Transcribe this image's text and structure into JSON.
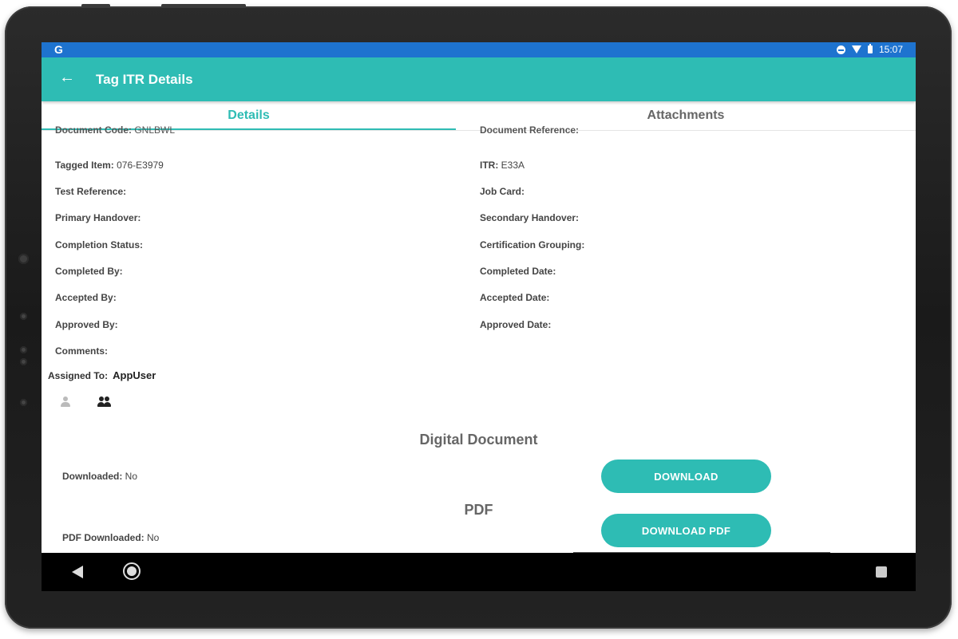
{
  "status_bar": {
    "left_glyph": "G",
    "time": "15:07",
    "icons": [
      "do-not-disturb-icon",
      "wifi-icon",
      "battery-icon"
    ]
  },
  "app_bar": {
    "back_icon": "arrow-back-icon",
    "title": "Tag ITR Details"
  },
  "tabs": [
    {
      "label": "Details",
      "active": true
    },
    {
      "label": "Attachments",
      "active": false
    }
  ],
  "details": {
    "left": [
      {
        "label": "Document Code:",
        "value": "GNLBWL"
      },
      {
        "label": "Tagged Item:",
        "value": "076-E3979"
      },
      {
        "label": "Test Reference:",
        "value": ""
      },
      {
        "label": "Primary Handover:",
        "value": ""
      },
      {
        "label": "Completion Status:",
        "value": ""
      },
      {
        "label": "Completed By:",
        "value": ""
      },
      {
        "label": "Accepted By:",
        "value": ""
      },
      {
        "label": "Approved By:",
        "value": ""
      },
      {
        "label": "Comments:",
        "value": ""
      }
    ],
    "right": [
      {
        "label": "Document Reference:",
        "value": ""
      },
      {
        "label": "ITR:",
        "value": "E33A"
      },
      {
        "label": "Job Card:",
        "value": ""
      },
      {
        "label": "Secondary Handover:",
        "value": ""
      },
      {
        "label": "Certification Grouping:",
        "value": ""
      },
      {
        "label": "Completed Date:",
        "value": ""
      },
      {
        "label": "Accepted Date:",
        "value": ""
      },
      {
        "label": "Approved Date:",
        "value": ""
      }
    ],
    "assigned_to": {
      "label": "Assigned To:",
      "value": "AppUser"
    },
    "assign_icons": [
      "person-icon",
      "group-icon"
    ]
  },
  "digital_document": {
    "title": "Digital Document",
    "downloaded_label": "Downloaded:",
    "downloaded_value": "No",
    "button": "DOWNLOAD"
  },
  "pdf": {
    "title": "PDF",
    "downloaded_label": "PDF Downloaded:",
    "downloaded_value": "No",
    "button": "DOWNLOAD PDF"
  },
  "colors": {
    "accent": "#2ebcb4",
    "status_bar": "#1e73cf",
    "nav_bar": "#000000"
  }
}
